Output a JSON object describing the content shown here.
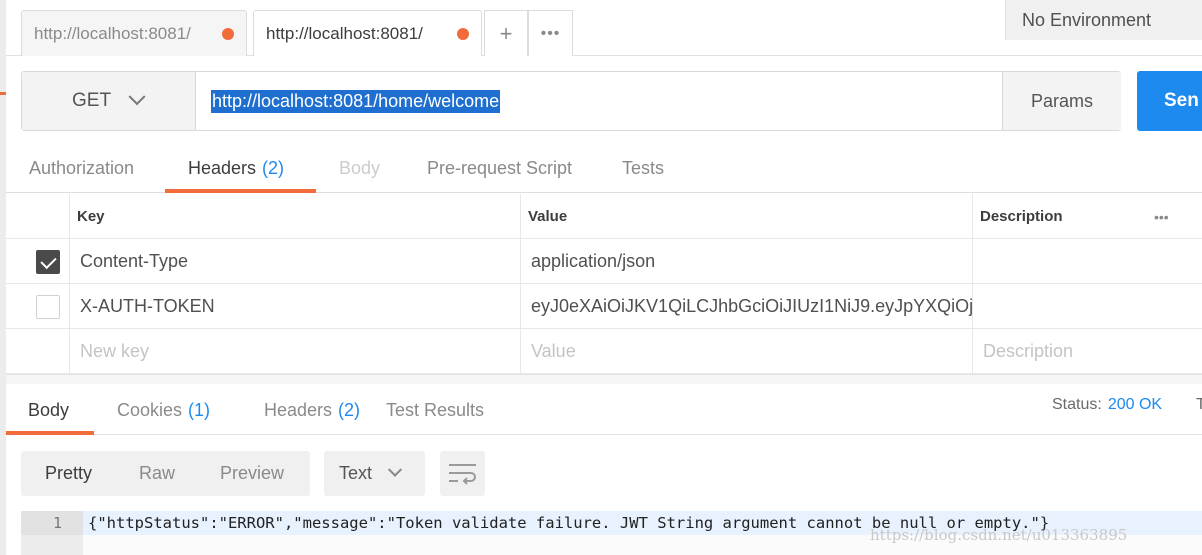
{
  "tabs": [
    {
      "label": "http://localhost:8081/",
      "active": false
    },
    {
      "label": "http://localhost:8081/",
      "active": true
    }
  ],
  "tab_tools": {
    "new_tab": "+",
    "more": "•••"
  },
  "environment": "No Environment",
  "request": {
    "method": "GET",
    "url": "http://localhost:8081/home/welcome",
    "params_label": "Params",
    "send_label": "Sen"
  },
  "request_tabs": [
    {
      "label": "Authorization",
      "count": ""
    },
    {
      "label": "Headers",
      "count": "(2)"
    },
    {
      "label": "Body",
      "count": ""
    },
    {
      "label": "Pre-request Script",
      "count": ""
    },
    {
      "label": "Tests",
      "count": ""
    }
  ],
  "headers_table": {
    "columns": {
      "key": "Key",
      "value": "Value",
      "description": "Description",
      "more": "•••"
    },
    "rows": [
      {
        "checked": true,
        "key": "Content-Type",
        "value": "application/json",
        "description": ""
      },
      {
        "checked": false,
        "key": "X-AUTH-TOKEN",
        "value": "eyJ0eXAiOiJKV1QiLCJhbGciOiJIUzI1NiJ9.eyJpYXQiOj...",
        "description": ""
      }
    ],
    "placeholders": {
      "key": "New key",
      "value": "Value",
      "description": "Description"
    }
  },
  "response_tabs": [
    {
      "label": "Body",
      "count": ""
    },
    {
      "label": "Cookies",
      "count": "(1)"
    },
    {
      "label": "Headers",
      "count": "(2)"
    },
    {
      "label": "Test Results",
      "count": ""
    }
  ],
  "status": {
    "label": "Status:",
    "value": "200 OK",
    "next": "T"
  },
  "format_tabs": [
    "Pretty",
    "Raw",
    "Preview"
  ],
  "format_type": "Text",
  "response_body": {
    "line_number": "1",
    "content": "{\"httpStatus\":\"ERROR\",\"message\":\"Token validate failure. JWT String argument cannot be null or empty.\"}"
  },
  "watermark": "https://blog.csdn.net/u013363895",
  "colors": {
    "accent_orange": "#f26b3a",
    "accent_blue": "#1d8af0",
    "selection": "#1f6fd1"
  }
}
